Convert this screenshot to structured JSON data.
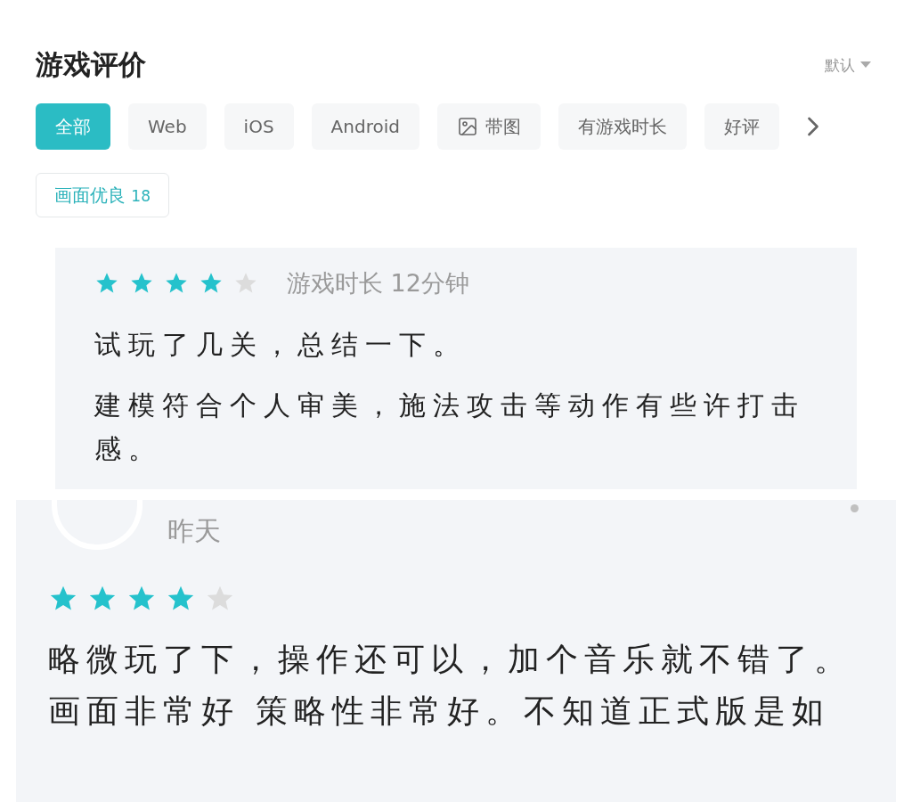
{
  "header": {
    "title": "游戏评价",
    "sort": "默认"
  },
  "filters": [
    {
      "label": "全部",
      "selected": true
    },
    {
      "label": "Web",
      "selected": false
    },
    {
      "label": "iOS",
      "selected": false
    },
    {
      "label": "Android",
      "selected": false
    },
    {
      "label": "带图",
      "selected": false,
      "kind": "image"
    },
    {
      "label": "有游戏时长",
      "selected": false
    },
    {
      "label": "好评",
      "selected": false
    }
  ],
  "tags": [
    {
      "label": "画面优良",
      "count": "18"
    }
  ],
  "reviews": [
    {
      "kind": "excerpt",
      "stars": 4,
      "playtime": "游戏时长 12分钟",
      "paragraphs": [
        "试玩了几关，总结一下。",
        "建模符合个人审美，施法攻击等动作有些许打击感。"
      ]
    },
    {
      "kind": "post",
      "date": "昨天",
      "stars": 4,
      "paragraphs": [
        "略微玩了下，操作还可以，加个音乐就不错了。",
        "画面非常好 策略性非常好。不知道正式版是如"
      ]
    }
  ]
}
